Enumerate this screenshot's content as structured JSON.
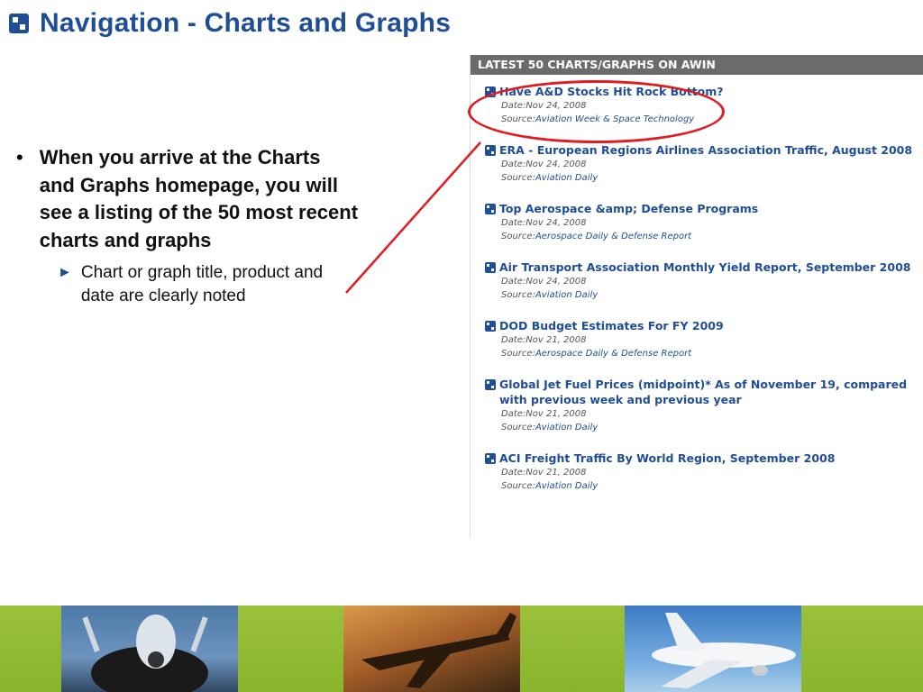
{
  "slide": {
    "title": "Navigation - Charts and Graphs",
    "title_icon": "blue-square-icon",
    "accent_color": "#1f4e96",
    "highlight_color": "#e11b22",
    "banner_color": "#8ab42c"
  },
  "bullets": {
    "main": "When you arrive at the Charts and Graphs homepage, you will see a listing of the 50 most recent charts and graphs",
    "sub": "Chart or graph title, product and date are clearly noted"
  },
  "panel": {
    "header": "LATEST 50 CHARTS/GRAPHS ON AWIN",
    "date_prefix": "Date:",
    "source_prefix": "Source:",
    "items": [
      {
        "title": "Have A&D Stocks Hit Rock Bottom?",
        "date": "Nov 24, 2008",
        "source": "Aviation Week & Space Technology"
      },
      {
        "title": "ERA - European Regions Airlines Association Traffic, August 2008",
        "date": "Nov 24, 2008",
        "source": "Aviation Daily"
      },
      {
        "title": "Top Aerospace &amp; Defense Programs",
        "date": "Nov 24, 2008",
        "source": "Aerospace Daily & Defense Report"
      },
      {
        "title": "Air Transport Association Monthly Yield Report, September 2008",
        "date": "Nov 24, 2008",
        "source": "Aviation Daily"
      },
      {
        "title": "DOD Budget Estimates For FY 2009",
        "date": "Nov 21, 2008",
        "source": "Aerospace Daily & Defense Report"
      },
      {
        "title": "Global Jet Fuel Prices (midpoint)* As of November 19, compared with previous week and previous year",
        "date": "Nov 21, 2008",
        "source": "Aviation Daily"
      },
      {
        "title": "ACI Freight Traffic By World Region, September 2008",
        "date": "Nov 21, 2008",
        "source": "Aviation Daily"
      }
    ]
  },
  "banner": {
    "photos": [
      "fighter-jet-photo",
      "business-jet-photo",
      "airliner-photo"
    ]
  }
}
